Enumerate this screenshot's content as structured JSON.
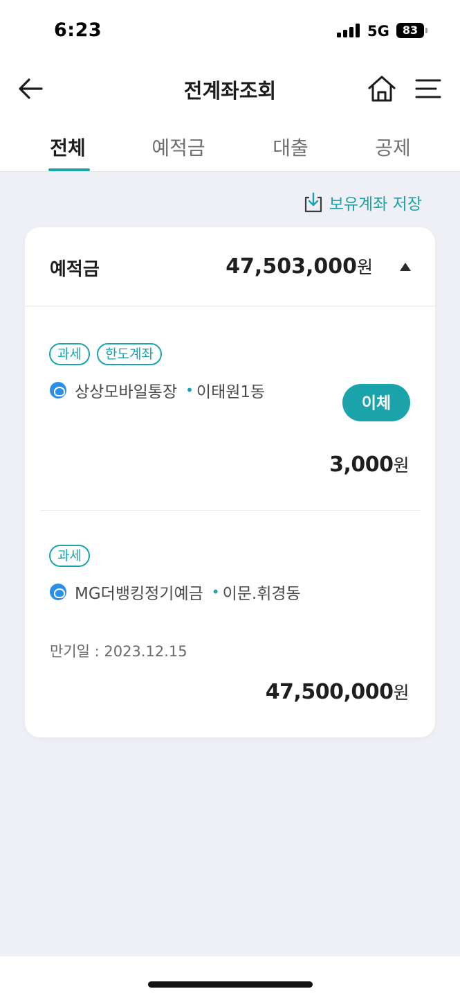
{
  "status_bar": {
    "time": "6:23",
    "network": "5G",
    "battery": "83"
  },
  "header": {
    "title": "전계좌조회"
  },
  "tabs": [
    {
      "label": "전체",
      "active": true
    },
    {
      "label": "예적금",
      "active": false
    },
    {
      "label": "대출",
      "active": false
    },
    {
      "label": "공제",
      "active": false
    }
  ],
  "save_link": {
    "label": "보유계좌 저장"
  },
  "section": {
    "label": "예적금",
    "total": "47,503,000",
    "unit": "원"
  },
  "accounts": [
    {
      "tags": [
        "과세",
        "한도계좌"
      ],
      "name": "상상모바일통장",
      "separator": "•",
      "branch": "이태원1동",
      "transfer_label": "이체",
      "amount": "3,000",
      "unit": "원"
    },
    {
      "tags": [
        "과세"
      ],
      "name": "MG더뱅킹정기예금",
      "separator": "•",
      "branch": "이문.휘경동",
      "maturity": "만기일 : 2023.12.15",
      "amount": "47,500,000",
      "unit": "원"
    }
  ],
  "colors": {
    "accent": "#1aa3aa",
    "bank_icon": "#2c8fe6",
    "background": "#eef0f5"
  }
}
